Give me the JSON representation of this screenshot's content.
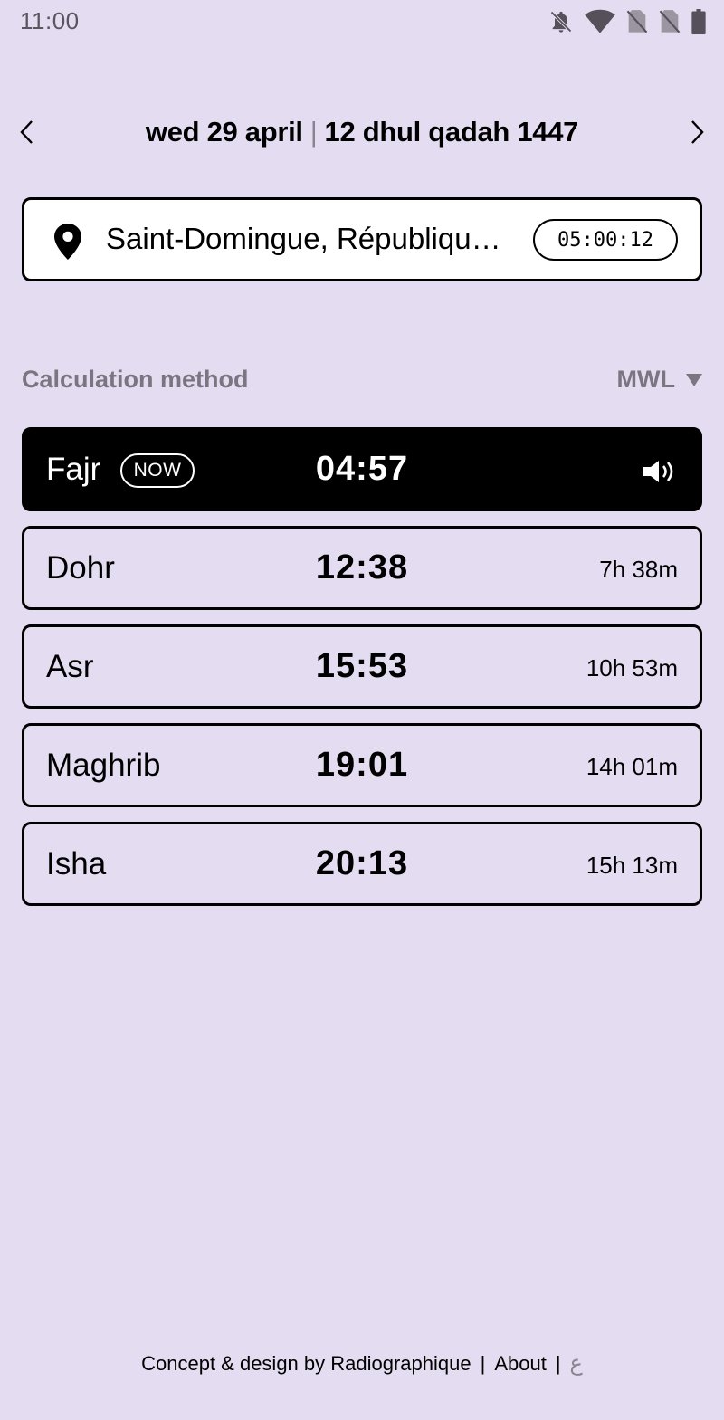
{
  "status_bar": {
    "time": "11:00",
    "icons": [
      "bell-off-icon",
      "wifi-icon",
      "no-sim-icon",
      "no-sim-icon",
      "battery-icon"
    ]
  },
  "header": {
    "gregorian_date": "wed 29 april",
    "separator": "|",
    "hijri_date": "12 dhul qadah 1447",
    "prev_icon": "chevron-left-icon",
    "next_icon": "chevron-right-icon"
  },
  "location": {
    "icon": "location-pin-icon",
    "name": "Saint-Domingue, République Dominicaine",
    "countdown": "05:00:12"
  },
  "calculation": {
    "label": "Calculation method",
    "value": "MWL",
    "dropdown_icon": "triangle-down-icon"
  },
  "prayers": [
    {
      "name": "Fajr",
      "badge": "NOW",
      "time": "04:57",
      "remaining": "",
      "active": true,
      "icon": "speaker-icon"
    },
    {
      "name": "Dohr",
      "badge": "",
      "time": "12:38",
      "remaining": "7h 38m",
      "active": false
    },
    {
      "name": "Asr",
      "badge": "",
      "time": "15:53",
      "remaining": "10h 53m",
      "active": false
    },
    {
      "name": "Maghrib",
      "badge": "",
      "time": "19:01",
      "remaining": "14h 01m",
      "active": false
    },
    {
      "name": "Isha",
      "badge": "",
      "time": "20:13",
      "remaining": "15h 13m",
      "active": false
    }
  ],
  "footer": {
    "credit": "Concept & design by Radiographique",
    "separator": "|",
    "about": "About",
    "language": "ع"
  },
  "colors": {
    "background": "#e4dcf0",
    "active_card": "#000000",
    "muted_text": "#7a7580"
  }
}
